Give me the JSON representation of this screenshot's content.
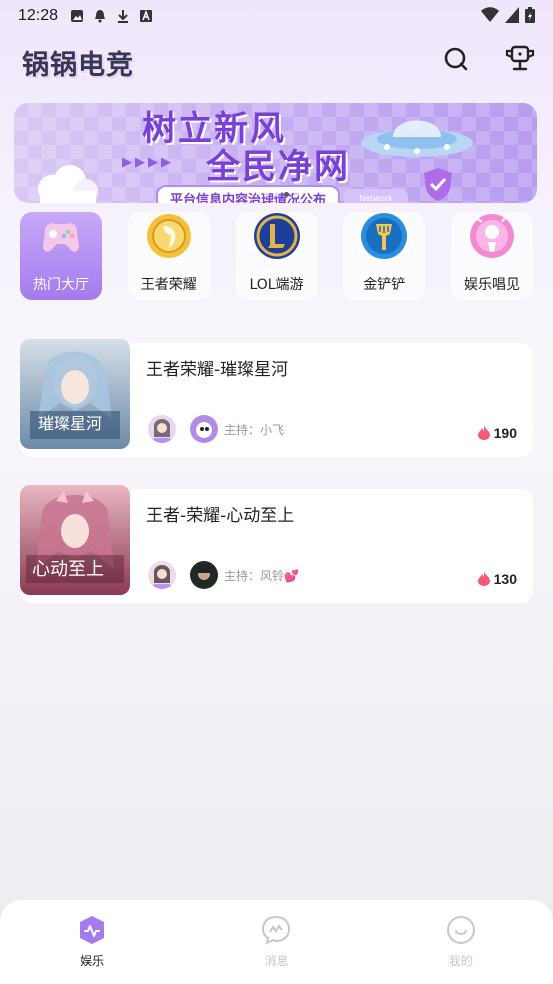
{
  "status": {
    "time": "12:28"
  },
  "header": {
    "title": "锅锅电竞",
    "icons": [
      "search-icon",
      "trophy-icon"
    ]
  },
  "banner": {
    "line1": "树立新风",
    "line2": "全民净网",
    "subtitle": "平台信息内容治理情况公布",
    "badge": "Network",
    "arrows": "▶▶▶▶"
  },
  "categories": [
    {
      "label": "热门大厅",
      "icon": "gamepad-icon",
      "active": true
    },
    {
      "label": "王者荣耀",
      "icon": "honor-of-kings-icon",
      "active": false
    },
    {
      "label": "LOL端游",
      "icon": "lol-icon",
      "active": false
    },
    {
      "label": "金铲铲",
      "icon": "golden-spatula-icon",
      "active": false
    },
    {
      "label": "娱乐唱见",
      "icon": "entertainment-icon",
      "active": false
    }
  ],
  "rooms": [
    {
      "title": "王者荣耀-璀璨星河",
      "thumb_text": "璀璨星河",
      "host_label": "主持：小飞",
      "heat": "190"
    },
    {
      "title": "王者-荣耀-心动至上",
      "thumb_text": "心动至上",
      "host_label": "主持：风铃💕",
      "heat": "130"
    }
  ],
  "nav": [
    {
      "label": "娱乐",
      "icon": "entertainment-nav-icon",
      "active": true
    },
    {
      "label": "消息",
      "icon": "message-icon",
      "active": false
    },
    {
      "label": "我的",
      "icon": "profile-icon",
      "active": false
    }
  ],
  "colors": {
    "accent": "#a47bee",
    "heat": "#f25b7a"
  }
}
